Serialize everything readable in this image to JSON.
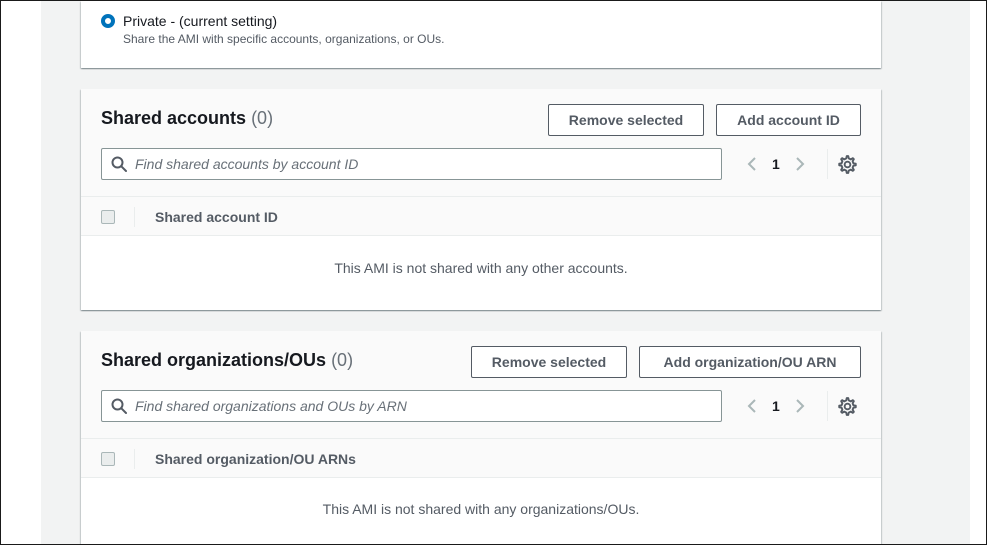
{
  "visibility": {
    "option_label": "Private - (current setting)",
    "option_description": "Share the AMI with specific accounts, organizations, or OUs.",
    "selected": true
  },
  "shared_accounts": {
    "title": "Shared accounts",
    "count": "(0)",
    "remove_label": "Remove selected",
    "add_label": "Add account ID",
    "search_placeholder": "Find shared accounts by account ID",
    "page": "1",
    "column_header": "Shared account ID",
    "empty_message": "This AMI is not shared with any other accounts."
  },
  "shared_orgs": {
    "title": "Shared organizations/OUs",
    "count": "(0)",
    "remove_label": "Remove selected",
    "add_label": "Add organization/OU ARN",
    "search_placeholder": "Find shared organizations and OUs by ARN",
    "page": "1",
    "column_header": "Shared organization/OU ARNs",
    "empty_message": "This AMI is not shared with any organizations/OUs."
  },
  "colors": {
    "accent": "#0073bb",
    "page_bg": "#f2f3f3",
    "text": "#16191f",
    "muted": "#545b64"
  },
  "icons": [
    "radio-selected-icon",
    "search-icon",
    "chevron-left-icon",
    "chevron-right-icon",
    "gear-icon"
  ]
}
